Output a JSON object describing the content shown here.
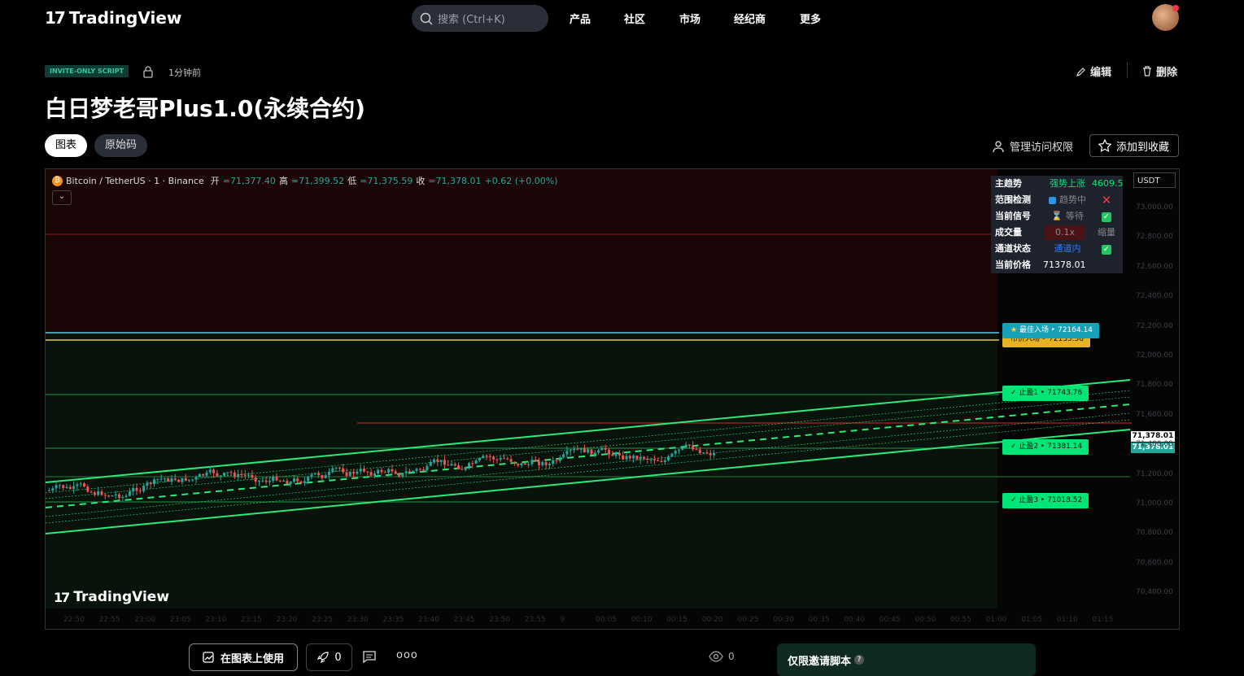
{
  "nav": {
    "brand": "TradingView",
    "search_placeholder": "搜索 (Ctrl+K)",
    "items": [
      "产品",
      "社区",
      "市场",
      "经纪商",
      "更多"
    ]
  },
  "script": {
    "badge": "INVITE-ONLY SCRIPT",
    "time": "1分钟前",
    "edit": "编辑",
    "delete": "删除",
    "title": "白日梦老哥Plus1.0(永续合约)",
    "tabs": [
      "图表",
      "原始码"
    ],
    "access": "管理访问权限",
    "favorite": "添加到收藏"
  },
  "legend": {
    "symbol": "Bitcoin / TetherUS · 1 · Binance",
    "open_label": "开",
    "open": "=71,377.40",
    "high_label": "高",
    "high": "=71,399.52",
    "low_label": "低",
    "low": "=71,375.59",
    "close_label": "收",
    "close": "=71,378.01",
    "change": "+0.62 (+0.00%)"
  },
  "currency": "USDT",
  "watermark": "TradingView",
  "panel": [
    {
      "label": "主趋势",
      "value": "强势上涨",
      "extra": "4609.5"
    },
    {
      "label": "范围检测",
      "value": "趋势中",
      "extra": "✕"
    },
    {
      "label": "当前信号",
      "value": "等待",
      "extra": "✓"
    },
    {
      "label": "成交量",
      "value": "0.1x",
      "extra": "缩量"
    },
    {
      "label": "通道状态",
      "value": "通道内",
      "extra": "✓"
    },
    {
      "label": "当前价格",
      "value": "71378.01",
      "extra": ""
    }
  ],
  "tags": {
    "best_entry": "最佳入场 ‣ 72164.14",
    "market_entry": "市价入场 ‣ 72135.56",
    "tp1": "✓ 止盈1 ‣ 71743.76",
    "tp2": "✓ 止盈2 ‣ 71381.14",
    "tp3": "✓ 止盈3 ‣ 71018.52"
  },
  "price_labels": [
    "71,378.01",
    "71,378.01"
  ],
  "price_axis": [
    "73,000.00",
    "72,800.00",
    "72,600.00",
    "72,400.00",
    "72,200.00",
    "72,000.00",
    "71,800.00",
    "71,600.00",
    "71,400.00",
    "71,200.00",
    "71,000.00",
    "70,800.00",
    "70,600.00",
    "70,400.00"
  ],
  "time_axis": [
    "22:50",
    "22:55",
    "23:00",
    "23:05",
    "23:10",
    "23:15",
    "23:20",
    "23:25",
    "23:30",
    "23:35",
    "23:40",
    "23:45",
    "23:50",
    "23:55",
    "9",
    "00:05",
    "00:10",
    "00:15",
    "00:20",
    "00:25",
    "00:30",
    "00:35",
    "00:40",
    "00:45",
    "00:50",
    "00:55",
    "01:00",
    "01:05",
    "01:10",
    "01:15"
  ],
  "bottom": {
    "use_on_chart": "在图表上使用",
    "boosts": "0",
    "views": "0",
    "invite_only": "仅限邀请脚本",
    "help": "?"
  },
  "colors": {
    "up": "#26a69a",
    "down": "#ef5350",
    "channel": "#2ee87a",
    "accent": "#00e676"
  }
}
